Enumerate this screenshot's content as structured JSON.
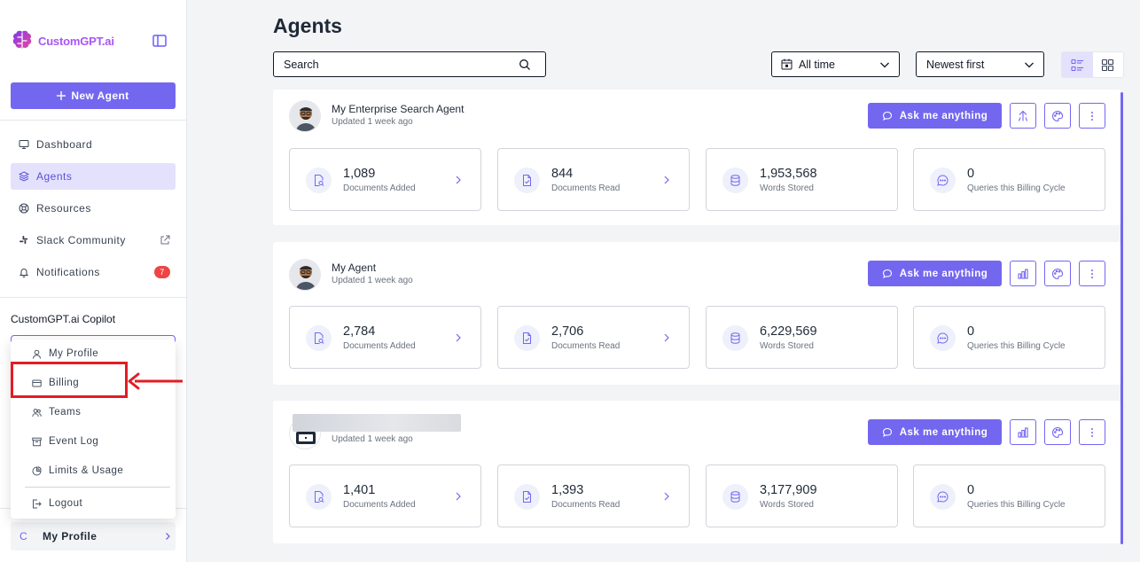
{
  "app": {
    "logo_text": "CustomGPT.ai",
    "accent": "#7367f0"
  },
  "sidebar": {
    "new_agent_label": "New Agent",
    "items": [
      {
        "label": "Dashboard",
        "icon": "monitor-icon"
      },
      {
        "label": "Agents",
        "icon": "layers-icon",
        "active": true
      },
      {
        "label": "Resources",
        "icon": "lifebuoy-icon"
      },
      {
        "label": "Slack Community",
        "icon": "slack-icon"
      },
      {
        "label": "Notifications",
        "icon": "bell-icon",
        "badge": "7"
      }
    ],
    "copilot_label": "CustomGPT.ai Copilot",
    "profile_menu": [
      {
        "label": "My Profile",
        "icon": "user-icon"
      },
      {
        "label": "Billing",
        "icon": "credit-card-icon"
      },
      {
        "label": "Teams",
        "icon": "users-icon"
      },
      {
        "label": "Event Log",
        "icon": "archive-icon"
      },
      {
        "label": "Limits & Usage",
        "icon": "pie-chart-icon"
      },
      {
        "label": "Logout",
        "icon": "logout-icon"
      }
    ],
    "profile": {
      "avatar_letter": "C",
      "name": "My Profile"
    }
  },
  "main": {
    "title": "Agents",
    "search": {
      "placeholder": "Search"
    },
    "date_filter": "All time",
    "sort": "Newest first",
    "ask_label": "Ask me anything",
    "agents": [
      {
        "name": "My Enterprise Search Agent",
        "updated": "Updated 1 week ago",
        "stats": [
          {
            "value": "1,089",
            "label": "Documents Added"
          },
          {
            "value": "844",
            "label": "Documents Read"
          },
          {
            "value": "1,953,568",
            "label": "Words Stored"
          },
          {
            "value": "0",
            "label": "Queries this Billing Cycle"
          }
        ]
      },
      {
        "name": "My Agent",
        "updated": "Updated 1 week ago",
        "stats": [
          {
            "value": "2,784",
            "label": "Documents Added"
          },
          {
            "value": "2,706",
            "label": "Documents Read"
          },
          {
            "value": "6,229,569",
            "label": "Words Stored"
          },
          {
            "value": "0",
            "label": "Queries this Billing Cycle"
          }
        ]
      },
      {
        "name": "",
        "updated": "Updated 1 week ago",
        "stats": [
          {
            "value": "1,401",
            "label": "Documents Added"
          },
          {
            "value": "1,393",
            "label": "Documents Read"
          },
          {
            "value": "3,177,909",
            "label": "Words Stored"
          },
          {
            "value": "0",
            "label": "Queries this Billing Cycle"
          }
        ]
      }
    ]
  }
}
